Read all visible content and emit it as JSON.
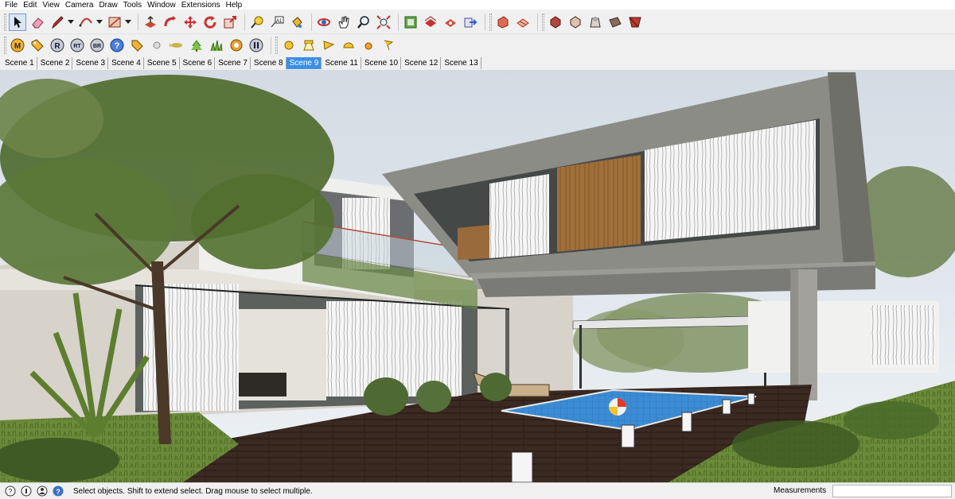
{
  "menu": [
    "File",
    "Edit",
    "View",
    "Camera",
    "Draw",
    "Tools",
    "Window",
    "Extensions",
    "Help"
  ],
  "toolbar_main": {
    "group_edit": [
      "select-arrow-icon",
      "eraser-icon",
      "pencil-line-icon",
      "arc-icon",
      "rectangle-icon"
    ],
    "group_modify": [
      "push-pull-icon",
      "follow-me-icon",
      "move-icon",
      "rotate-icon",
      "scale-icon"
    ],
    "group_construct": [
      "tape-measure-icon",
      "text-label-icon",
      "paint-bucket-icon"
    ],
    "group_camera": [
      "orbit-icon",
      "pan-hand-icon",
      "zoom-icon",
      "zoom-extents-icon"
    ],
    "group_warehouse": [
      "3d-warehouse-icon",
      "share-model-icon",
      "component-warehouse-icon",
      "export-icon"
    ],
    "group_sandbox": [
      "section-plane-icon",
      "section-cut-icon"
    ],
    "group_styles": [
      "xray-style-icon",
      "wireframe-style-icon",
      "hidden-line-style-icon",
      "shaded-style-icon",
      "textured-style-icon"
    ]
  },
  "toolbar_render": {
    "letter_buttons": [
      "M",
      "R",
      "RT",
      "BR"
    ],
    "help_icon": "?",
    "group_lights": [
      "sphere-light-icon",
      "spot-light-icon",
      "cone-light-icon",
      "hemisphere-light-icon",
      "omni-light-icon",
      "light-flag-icon"
    ]
  },
  "scenes": {
    "tabs": [
      "Scene 1",
      "Scene 2",
      "Scene 3",
      "Scene 4",
      "Scene 5",
      "Scene 6",
      "Scene 7",
      "Scene 8",
      "Scene 9",
      "Scene 11",
      "Scene 10",
      "Scene 12",
      "Scene 13"
    ],
    "active": "Scene 9"
  },
  "status": {
    "message": "Select objects. Shift to extend select. Drag mouse to select multiple.",
    "measurements_label": "Measurements",
    "measurements_value": ""
  },
  "colors": {
    "accent_tab": "#3d8ee6",
    "sky": "#dfe6ee",
    "concrete": "#8c8c87",
    "wood": "#9a6b33",
    "pool": "#3f8fd2",
    "foliage": "#4f6b2e"
  }
}
